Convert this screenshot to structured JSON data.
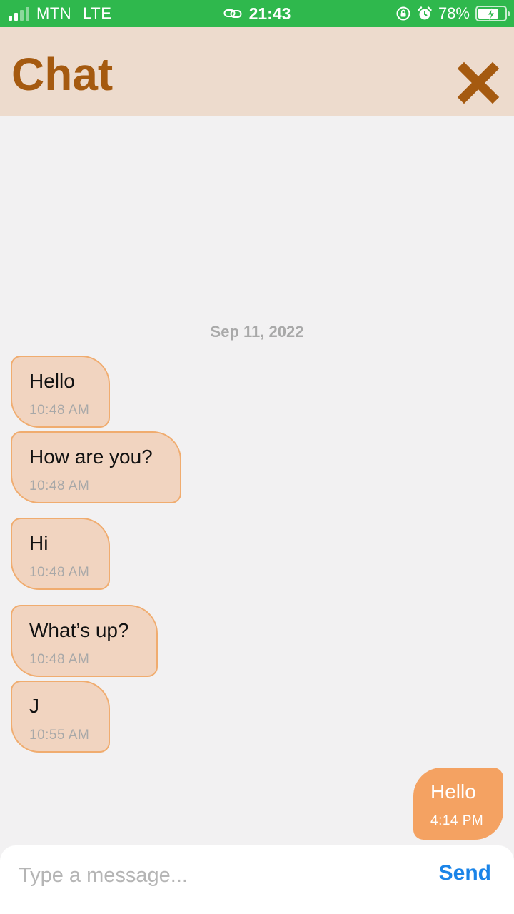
{
  "status_bar": {
    "carrier": "MTN",
    "network": "LTE",
    "time": "21:43",
    "battery_percent": "78%",
    "battery_level": 0.78,
    "color": "#2fb84d"
  },
  "header": {
    "title": "Chat",
    "close_icon": "close-icon",
    "background": "#eddbcd",
    "accent": "#a55a10"
  },
  "conversation": {
    "date_separator": "Sep 11, 2022",
    "messages": [
      {
        "text": "Hello",
        "time": "10:48 AM",
        "direction": "incoming"
      },
      {
        "text": "How are you?",
        "time": "10:48 AM",
        "direction": "incoming"
      },
      {
        "text": "Hi",
        "time": "10:48 AM",
        "direction": "incoming"
      },
      {
        "text": "What’s up?",
        "time": "10:48 AM",
        "direction": "incoming"
      },
      {
        "text": "J",
        "time": "10:55 AM",
        "direction": "incoming"
      },
      {
        "text": "Hello",
        "time": "4:14 PM",
        "direction": "outgoing"
      }
    ]
  },
  "composer": {
    "placeholder": "Type a message...",
    "value": "",
    "send_label": "Send"
  }
}
